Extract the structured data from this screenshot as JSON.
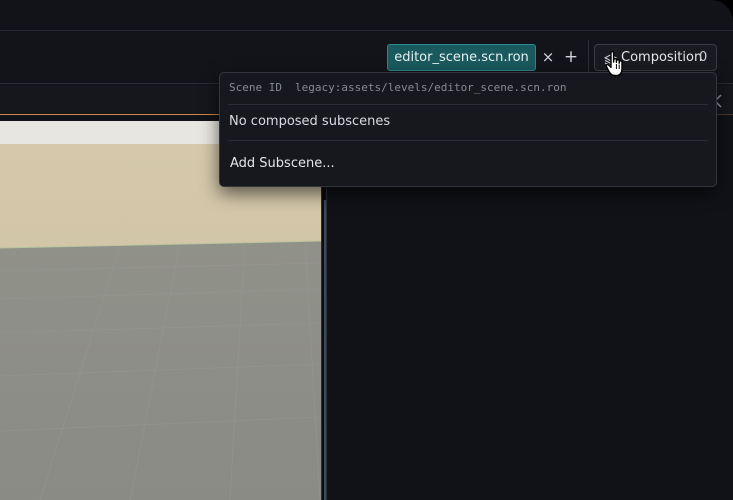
{
  "toolbar": {
    "scene_tab_label": "editor_scene.scn.ron",
    "close_tab_glyph": "×",
    "add_tab_glyph": "+",
    "composition_label": "Composition",
    "composition_count": "0"
  },
  "popover": {
    "scene_id_label": "Scene ID",
    "scene_id_value": "legacy:assets/levels/editor_scene.scn.ron",
    "empty_message": "No composed subscenes",
    "add_subscene_label": "Add Subscene..."
  },
  "icons": {
    "composition": "layers-icon",
    "cursor": "hand-pointer-icon",
    "panel_toggle": "chevron-left-icon"
  },
  "colors": {
    "accent_tab": "#1a5a5e",
    "panel_border_accent": "#c98a4a",
    "window_bg": "#121318"
  }
}
